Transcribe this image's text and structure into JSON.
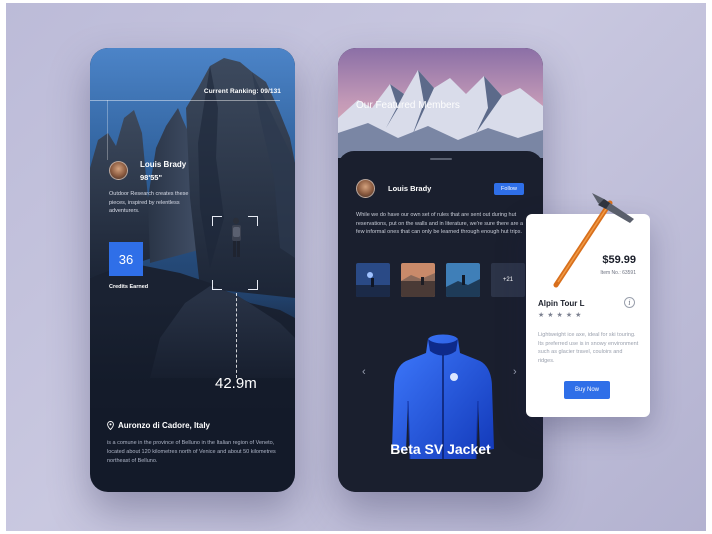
{
  "screen1": {
    "ranking": "Current Ranking: 09/131",
    "member_name": "Louis Brady",
    "member_time": "98'55\"",
    "member_desc": "Outdoor Research creates these pieces, inspired by relentless adventurers.",
    "credits_value": "36",
    "credits_label": "Credits Earned",
    "height_value": "42.9m",
    "location_name": "Auronzo di Cadore, Italy",
    "location_desc": "is a comune in the province of Belluno in the Italian region of Veneto, located about 120 kilometres north of Venice and about 50 kilometres northeast of Belluno."
  },
  "screen2": {
    "featured_title": "Our Featured Members",
    "member_name": "Louis Brady",
    "follow_label": "Follow",
    "description": "While we do have our own set of rules that are sent out during hut reservations, put on the walls and in literature, we're sure there are a few informal ones that can only be learned through enough hut trips.",
    "thumbs_more": "+21",
    "product_name": "Beta SV Jacket"
  },
  "product_card": {
    "price": "$59.99",
    "item_code": "Item No.: 63591",
    "title": "Alpin Tour L",
    "stars": "★★★★★",
    "description": "Lightweight ice axe, ideal for ski touring. Its preferred use is in snowy environment such as glacier travel, couloirs and ridges.",
    "buy_label": "Buy Now"
  },
  "icons": {
    "location": "map-pin-icon",
    "info": "info-icon",
    "prev": "chevron-left-icon",
    "next": "chevron-right-icon"
  },
  "colors": {
    "accent": "#2f6fe8",
    "dark_surface": "#1a1f2e",
    "background": "#c4c3dc"
  }
}
